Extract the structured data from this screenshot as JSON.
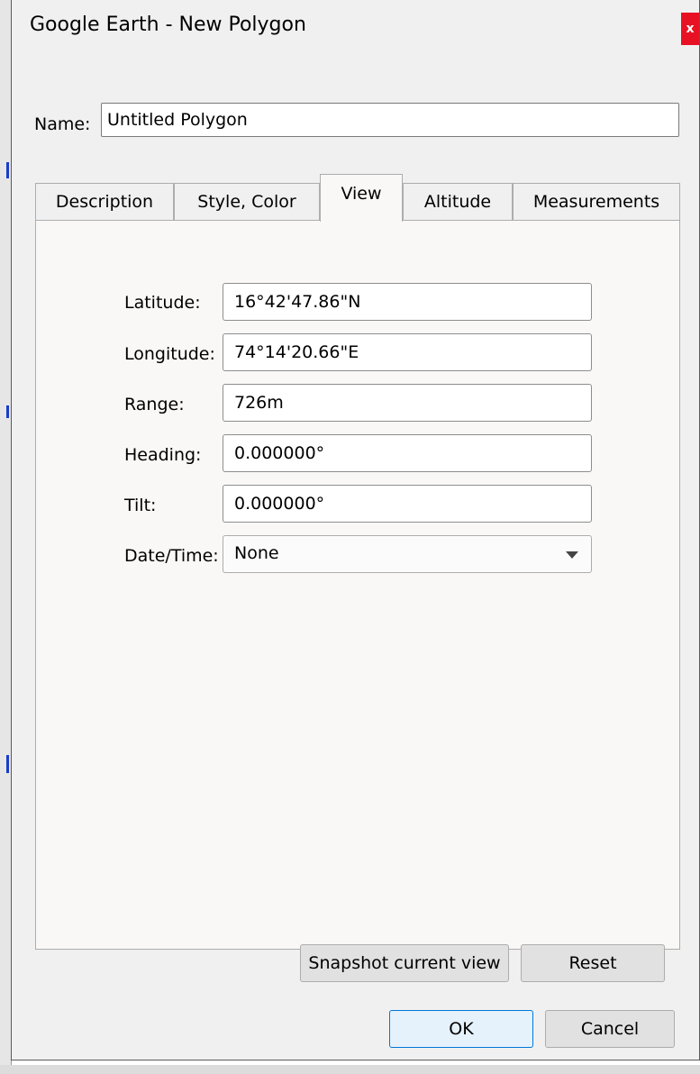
{
  "window": {
    "title": "Google Earth - New Polygon",
    "close_label": "x"
  },
  "name": {
    "label": "Name:",
    "value": "Untitled Polygon"
  },
  "tabs": [
    {
      "label": "Description",
      "active": false
    },
    {
      "label": "Style, Color",
      "active": false
    },
    {
      "label": "View",
      "active": true
    },
    {
      "label": "Altitude",
      "active": false
    },
    {
      "label": "Measurements",
      "active": false
    }
  ],
  "view": {
    "latitude": {
      "label": "Latitude:",
      "value": "16°42'47.86\"N"
    },
    "longitude": {
      "label": "Longitude:",
      "value": "74°14'20.66\"E"
    },
    "range": {
      "label": "Range:",
      "value": "726m"
    },
    "heading": {
      "label": "Heading:",
      "value": "0.000000°"
    },
    "tilt": {
      "label": "Tilt:",
      "value": "0.000000°"
    },
    "datetime": {
      "label": "Date/Time:",
      "value": "None"
    },
    "snapshot_label": "Snapshot current view",
    "reset_label": "Reset"
  },
  "footer": {
    "ok_label": "OK",
    "cancel_label": "Cancel"
  },
  "colors": {
    "close_button": "#e81123",
    "default_button_border": "#0078d7",
    "panel_background": "#faf8f6",
    "dialog_background": "#f0f0f0"
  },
  "icons": {
    "close": "close-icon",
    "dropdown": "chevron-down-icon"
  }
}
